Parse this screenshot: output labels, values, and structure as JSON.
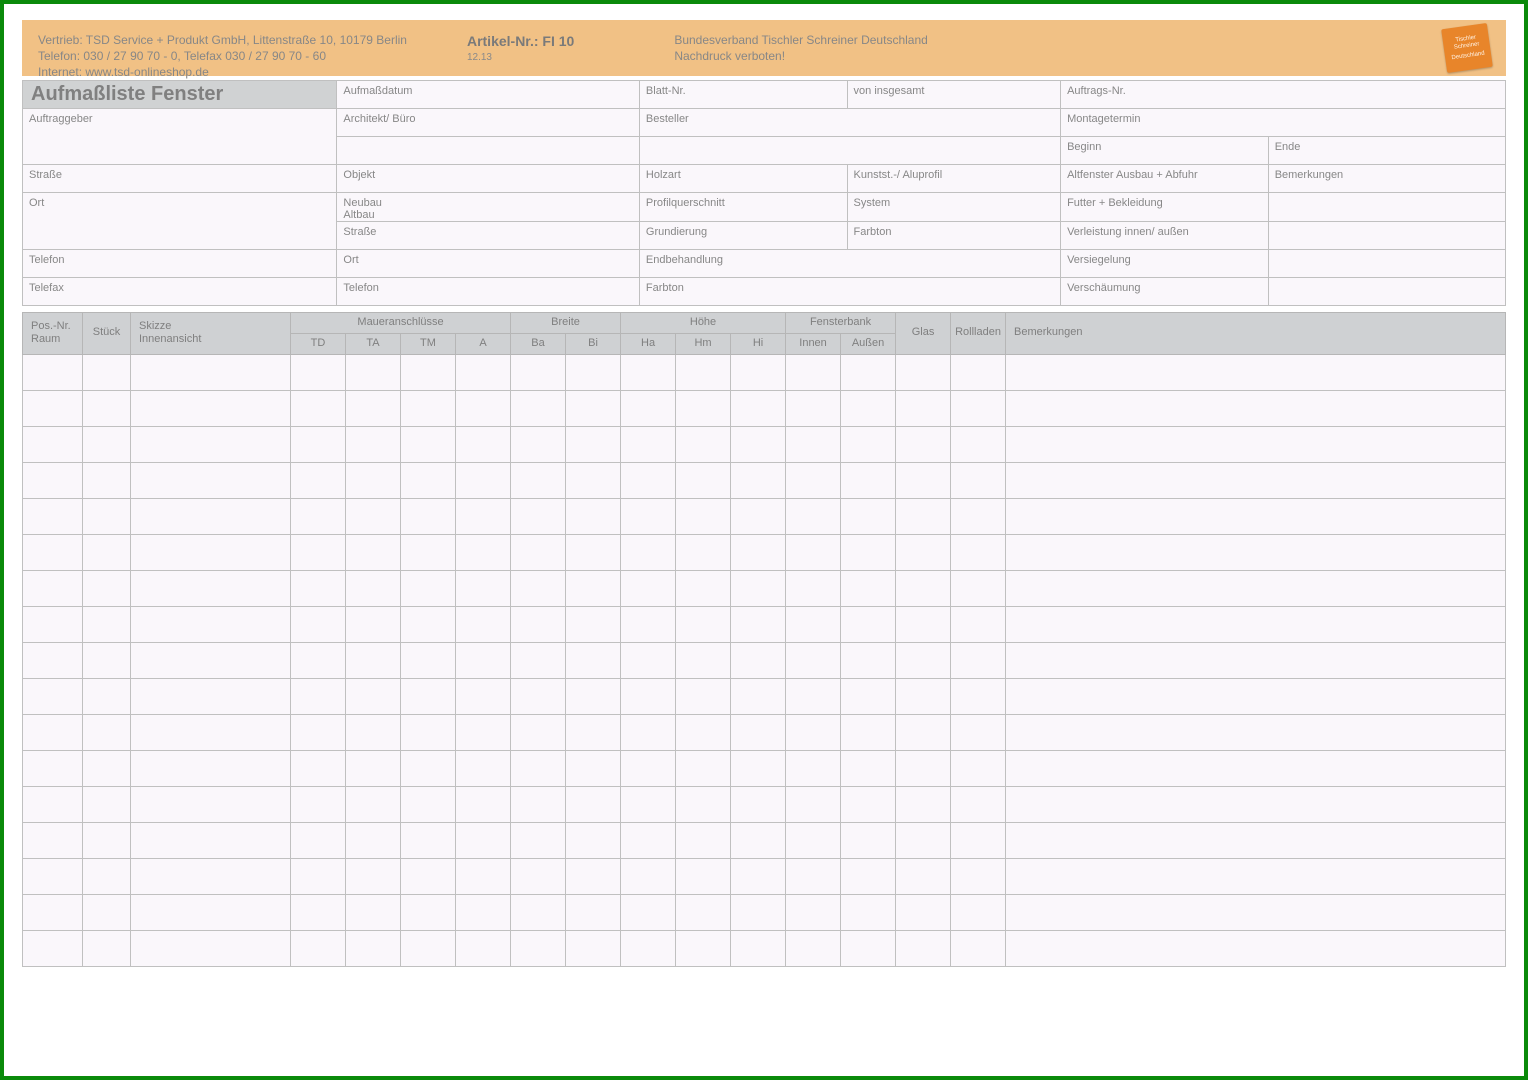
{
  "banner": {
    "vertrieb": "Vertrieb: TSD Service + Produkt GmbH, Littenstraße 10, 10179 Berlin",
    "telefon": "Telefon: 030 / 27 90 70 - 0, Telefax 030 / 27 90 70 - 60",
    "internet": "Internet: www.tsd-onlineshop.de",
    "artikel": "Artikel-Nr.: FI 10",
    "artikel_sub": "12.13",
    "verband": "Bundesverband Tischler Schreiner Deutschland",
    "nachdruck": "Nachdruck verboten!",
    "logo_line1": "Tischler",
    "logo_line2": "Schreiner",
    "logo_line3": "Deutschland"
  },
  "title": "Aufmaßliste Fenster",
  "meta": {
    "aufmassdatum": "Aufmaßdatum",
    "blatt_nr": "Blatt-Nr.",
    "von_insgesamt": "von insgesamt",
    "auftrags_nr": "Auftrags-Nr.",
    "auftraggeber": "Auftraggeber",
    "architekt": "Architekt/ Büro",
    "besteller": "Besteller",
    "montagetermin": "Montagetermin",
    "beginn": "Beginn",
    "ende": "Ende",
    "strasse": "Straße",
    "objekt": "Objekt",
    "holzart": "Holzart",
    "kunstst": "Kunstst.-/ Aluprofil",
    "altfenster": "Altfenster Ausbau + Abfuhr",
    "bemerkungen": "Bemerkungen",
    "ort": "Ort",
    "neubau_altbau": "Neubau\nAltbau",
    "profilquerschnitt": "Profilquerschnitt",
    "system": "System",
    "futter": "Futter + Bekleidung",
    "strasse2": "Straße",
    "grundierung": "Grundierung",
    "farbton": "Farbton",
    "verleistung": "Verleistung innen/ außen",
    "telefon": "Telefon",
    "ort2": "Ort",
    "endbehandlung": "Endbehandlung",
    "versiegelung": "Versiegelung",
    "telefax": "Telefax",
    "telefon2": "Telefon",
    "farbton2": "Farbton",
    "verschaeumung": "Verschäumung"
  },
  "columns": {
    "pos_nr": "Pos.-Nr.",
    "raum": "Raum",
    "stueck": "Stück",
    "skizze": "Skizze",
    "innenansicht": "Innenansicht",
    "maueranschluesse": "Maueranschlüsse",
    "td": "TD",
    "ta": "TA",
    "tm": "TM",
    "a": "A",
    "breite": "Breite",
    "ba": "Ba",
    "bi": "Bi",
    "hoehe": "Höhe",
    "ha": "Ha",
    "hm": "Hm",
    "hi": "Hi",
    "fensterbank": "Fensterbank",
    "innen": "Innen",
    "aussen": "Außen",
    "glas": "Glas",
    "rollladen": "Rollladen",
    "bemerkungen": "Bemerkungen"
  },
  "row_count": 17
}
